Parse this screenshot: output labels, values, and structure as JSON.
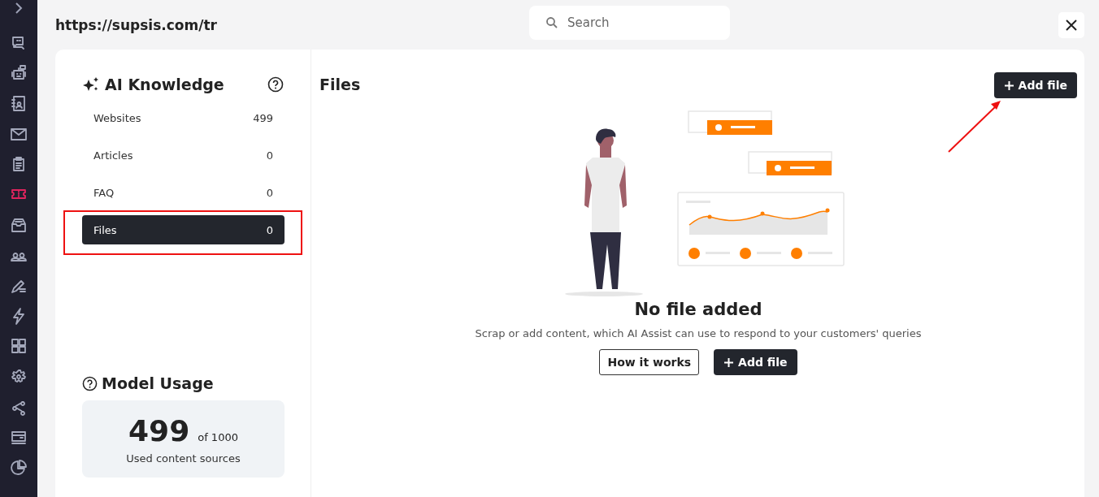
{
  "sidebar": {
    "items": [
      {
        "selected": false
      },
      {
        "selected": false
      },
      {
        "selected": false
      },
      {
        "selected": false
      },
      {
        "selected": false
      },
      {
        "selected": true
      },
      {
        "selected": false
      },
      {
        "selected": false
      },
      {
        "selected": false
      },
      {
        "selected": false
      },
      {
        "selected": false
      },
      {
        "selected": false
      },
      {
        "selected": false
      },
      {
        "selected": false
      },
      {
        "selected": false
      }
    ]
  },
  "header": {
    "url": "https://supsis.com/tr",
    "search": {
      "placeholder": "Search"
    }
  },
  "knowledge": {
    "title": "AI Knowledge",
    "items": [
      {
        "label": "Websites",
        "count": "499",
        "selected": false
      },
      {
        "label": "Articles",
        "count": "0",
        "selected": false
      },
      {
        "label": "FAQ",
        "count": "0",
        "selected": false
      },
      {
        "label": "Files",
        "count": "0",
        "selected": true
      }
    ]
  },
  "usage": {
    "title": "Model Usage",
    "used": "499",
    "total": "of 1000",
    "caption": "Used content sources"
  },
  "files": {
    "title": "Files",
    "add_button": "Add file",
    "empty": {
      "title": "No file added",
      "text": "Scrap or add content, which AI Assist can use to respond to your customers' queries",
      "buttons": [
        {
          "kind": "outline",
          "label": "How it works"
        },
        {
          "kind": "add",
          "label": "Add file"
        }
      ]
    }
  }
}
